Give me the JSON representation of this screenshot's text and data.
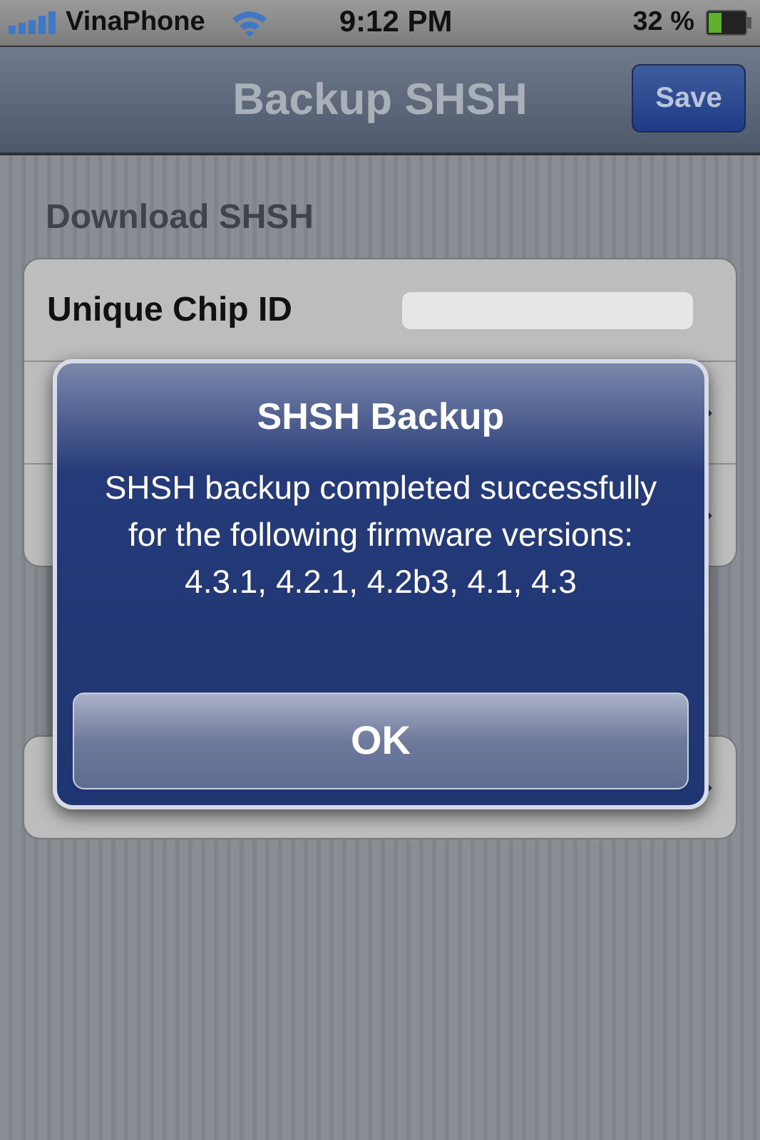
{
  "status_bar": {
    "carrier": "VinaPhone",
    "time": "9:12 PM",
    "battery": "32 %"
  },
  "nav_bar": {
    "title": "Backup SHSH",
    "button": "Save"
  },
  "sections": [
    {
      "header": "Download SHSH",
      "rows": [
        {
          "kind": "field",
          "label": "Unique Chip ID"
        },
        {
          "kind": "detail"
        },
        {
          "kind": "detail"
        }
      ]
    },
    {
      "rows": [
        {
          "kind": "link"
        }
      ]
    }
  ],
  "alert": {
    "title": "SHSH Backup",
    "message": "SHSH backup completed successfully for the following firmware versions: 4.3.1, 4.2.1, 4.2b3, 4.1, 4.3",
    "button": "OK"
  }
}
